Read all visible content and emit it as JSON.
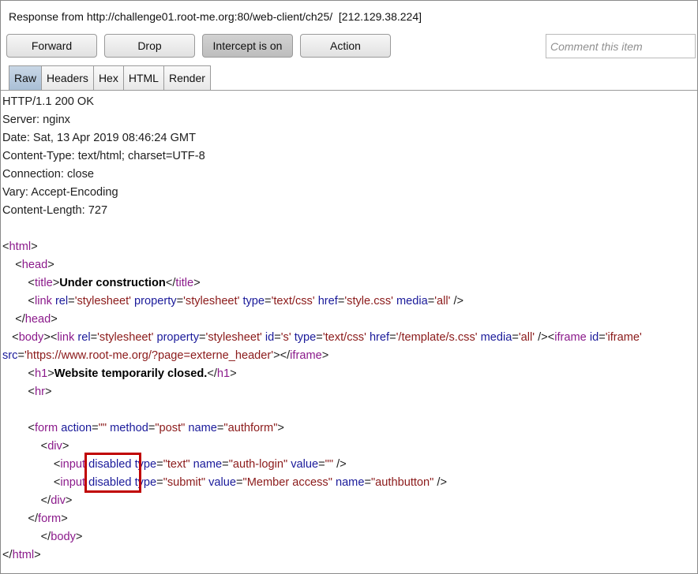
{
  "window": {
    "title": "Response from http://challenge01.root-me.org:80/web-client/ch25/  [212.129.38.224]"
  },
  "toolbar": {
    "forward_label": "Forward",
    "drop_label": "Drop",
    "intercept_label": "Intercept is on",
    "action_label": "Action",
    "comment_placeholder": "Comment this item"
  },
  "tabs": [
    "Raw",
    "Headers",
    "Hex",
    "HTML",
    "Render"
  ],
  "selected_tab": "Raw",
  "headers": [
    "HTTP/1.1 200 OK",
    "Server: nginx",
    "Date: Sat, 13 Apr 2019 08:46:24 GMT",
    "Content-Type: text/html; charset=UTF-8",
    "Connection: close",
    "Vary: Accept-Encoding",
    "Content-Length: 727"
  ],
  "body_lines": [
    [
      {
        "k": "p",
        "s": "<"
      },
      {
        "k": "t",
        "s": "html"
      },
      {
        "k": "p",
        "s": ">"
      }
    ],
    [
      {
        "k": "p",
        "s": "    <"
      },
      {
        "k": "t",
        "s": "head"
      },
      {
        "k": "p",
        "s": ">"
      }
    ],
    [
      {
        "k": "p",
        "s": "        <"
      },
      {
        "k": "t",
        "s": "title"
      },
      {
        "k": "p",
        "s": ">"
      },
      {
        "k": "b",
        "s": "Under construction"
      },
      {
        "k": "p",
        "s": "</"
      },
      {
        "k": "t",
        "s": "title"
      },
      {
        "k": "p",
        "s": ">"
      }
    ],
    [
      {
        "k": "p",
        "s": "        <"
      },
      {
        "k": "t",
        "s": "link"
      },
      {
        "k": "p",
        "s": " "
      },
      {
        "k": "a",
        "s": "rel"
      },
      {
        "k": "p",
        "s": "="
      },
      {
        "k": "v",
        "s": "'stylesheet'"
      },
      {
        "k": "p",
        "s": " "
      },
      {
        "k": "a",
        "s": "property"
      },
      {
        "k": "p",
        "s": "="
      },
      {
        "k": "v",
        "s": "'stylesheet'"
      },
      {
        "k": "p",
        "s": " "
      },
      {
        "k": "a",
        "s": "type"
      },
      {
        "k": "p",
        "s": "="
      },
      {
        "k": "v",
        "s": "'text/css'"
      },
      {
        "k": "p",
        "s": " "
      },
      {
        "k": "a",
        "s": "href"
      },
      {
        "k": "p",
        "s": "="
      },
      {
        "k": "v",
        "s": "'style.css'"
      },
      {
        "k": "p",
        "s": " "
      },
      {
        "k": "a",
        "s": "media"
      },
      {
        "k": "p",
        "s": "="
      },
      {
        "k": "v",
        "s": "'all'"
      },
      {
        "k": "p",
        "s": " />"
      }
    ],
    [
      {
        "k": "p",
        "s": "    </"
      },
      {
        "k": "t",
        "s": "head"
      },
      {
        "k": "p",
        "s": ">"
      }
    ],
    [
      {
        "k": "p",
        "s": "   <"
      },
      {
        "k": "t",
        "s": "body"
      },
      {
        "k": "p",
        "s": "><"
      },
      {
        "k": "t",
        "s": "link"
      },
      {
        "k": "p",
        "s": " "
      },
      {
        "k": "a",
        "s": "rel"
      },
      {
        "k": "p",
        "s": "="
      },
      {
        "k": "v",
        "s": "'stylesheet'"
      },
      {
        "k": "p",
        "s": " "
      },
      {
        "k": "a",
        "s": "property"
      },
      {
        "k": "p",
        "s": "="
      },
      {
        "k": "v",
        "s": "'stylesheet'"
      },
      {
        "k": "p",
        "s": " "
      },
      {
        "k": "a",
        "s": "id"
      },
      {
        "k": "p",
        "s": "="
      },
      {
        "k": "v",
        "s": "'s'"
      },
      {
        "k": "p",
        "s": " "
      },
      {
        "k": "a",
        "s": "type"
      },
      {
        "k": "p",
        "s": "="
      },
      {
        "k": "v",
        "s": "'text/css'"
      },
      {
        "k": "p",
        "s": " "
      },
      {
        "k": "a",
        "s": "href"
      },
      {
        "k": "p",
        "s": "="
      },
      {
        "k": "v",
        "s": "'/template/s.css'"
      },
      {
        "k": "p",
        "s": " "
      },
      {
        "k": "a",
        "s": "media"
      },
      {
        "k": "p",
        "s": "="
      },
      {
        "k": "v",
        "s": "'all'"
      },
      {
        "k": "p",
        "s": " /><"
      },
      {
        "k": "t",
        "s": "iframe"
      },
      {
        "k": "p",
        "s": " "
      },
      {
        "k": "a",
        "s": "id"
      },
      {
        "k": "p",
        "s": "="
      },
      {
        "k": "v",
        "s": "'iframe'"
      }
    ],
    [
      {
        "k": "a",
        "s": "src"
      },
      {
        "k": "p",
        "s": "="
      },
      {
        "k": "v",
        "s": "'https://www.root-me.org/?page=externe_header'"
      },
      {
        "k": "p",
        "s": "></"
      },
      {
        "k": "t",
        "s": "iframe"
      },
      {
        "k": "p",
        "s": ">"
      }
    ],
    [
      {
        "k": "p",
        "s": "        <"
      },
      {
        "k": "t",
        "s": "h1"
      },
      {
        "k": "p",
        "s": ">"
      },
      {
        "k": "b",
        "s": "Website temporarily closed."
      },
      {
        "k": "p",
        "s": "</"
      },
      {
        "k": "t",
        "s": "h1"
      },
      {
        "k": "p",
        "s": ">"
      }
    ],
    [
      {
        "k": "p",
        "s": "        <"
      },
      {
        "k": "t",
        "s": "hr"
      },
      {
        "k": "p",
        "s": ">"
      }
    ],
    [],
    [
      {
        "k": "p",
        "s": "        <"
      },
      {
        "k": "t",
        "s": "form"
      },
      {
        "k": "p",
        "s": " "
      },
      {
        "k": "a",
        "s": "action"
      },
      {
        "k": "p",
        "s": "="
      },
      {
        "k": "v",
        "s": "\"\""
      },
      {
        "k": "p",
        "s": " "
      },
      {
        "k": "a",
        "s": "method"
      },
      {
        "k": "p",
        "s": "="
      },
      {
        "k": "v",
        "s": "\"post\""
      },
      {
        "k": "p",
        "s": " "
      },
      {
        "k": "a",
        "s": "name"
      },
      {
        "k": "p",
        "s": "="
      },
      {
        "k": "v",
        "s": "\"authform\""
      },
      {
        "k": "p",
        "s": ">"
      }
    ],
    [
      {
        "k": "p",
        "s": "            <"
      },
      {
        "k": "t",
        "s": "div"
      },
      {
        "k": "p",
        "s": ">"
      }
    ],
    [
      {
        "k": "p",
        "s": "                <"
      },
      {
        "k": "t",
        "s": "input"
      },
      {
        "k": "p",
        "s": " "
      },
      {
        "k": "a",
        "s": "disabled"
      },
      {
        "k": "p",
        "s": " "
      },
      {
        "k": "a",
        "s": "type"
      },
      {
        "k": "p",
        "s": "="
      },
      {
        "k": "v",
        "s": "\"text\""
      },
      {
        "k": "p",
        "s": " "
      },
      {
        "k": "a",
        "s": "name"
      },
      {
        "k": "p",
        "s": "="
      },
      {
        "k": "v",
        "s": "\"auth-login\""
      },
      {
        "k": "p",
        "s": " "
      },
      {
        "k": "a",
        "s": "value"
      },
      {
        "k": "p",
        "s": "="
      },
      {
        "k": "v",
        "s": "\"\""
      },
      {
        "k": "p",
        "s": " />"
      }
    ],
    [
      {
        "k": "p",
        "s": "                <"
      },
      {
        "k": "t",
        "s": "input"
      },
      {
        "k": "p",
        "s": " "
      },
      {
        "k": "a",
        "s": "disabled"
      },
      {
        "k": "p",
        "s": " "
      },
      {
        "k": "a",
        "s": "type"
      },
      {
        "k": "p",
        "s": "="
      },
      {
        "k": "v",
        "s": "\"submit\""
      },
      {
        "k": "p",
        "s": " "
      },
      {
        "k": "a",
        "s": "value"
      },
      {
        "k": "p",
        "s": "="
      },
      {
        "k": "v",
        "s": "\"Member access\""
      },
      {
        "k": "p",
        "s": " "
      },
      {
        "k": "a",
        "s": "name"
      },
      {
        "k": "p",
        "s": "="
      },
      {
        "k": "v",
        "s": "\"authbutton\""
      },
      {
        "k": "p",
        "s": " />"
      }
    ],
    [
      {
        "k": "p",
        "s": "            </"
      },
      {
        "k": "t",
        "s": "div"
      },
      {
        "k": "p",
        "s": ">"
      }
    ],
    [
      {
        "k": "p",
        "s": "        </"
      },
      {
        "k": "t",
        "s": "form"
      },
      {
        "k": "p",
        "s": ">"
      }
    ],
    [
      {
        "k": "p",
        "s": "            </"
      },
      {
        "k": "t",
        "s": "body"
      },
      {
        "k": "p",
        "s": ">"
      }
    ],
    [
      {
        "k": "p",
        "s": "</"
      },
      {
        "k": "t",
        "s": "html"
      },
      {
        "k": "p",
        "s": ">"
      }
    ]
  ],
  "colors": {
    "tag": "#8b1a8b",
    "attribute": "#1a1a9a",
    "value": "#8b1a1a",
    "highlight_box": "#c00000",
    "selected_tab": "#a9bfd6"
  }
}
